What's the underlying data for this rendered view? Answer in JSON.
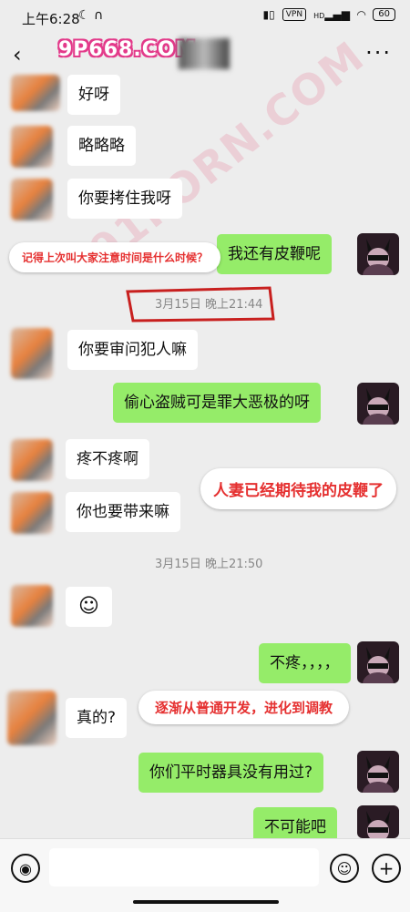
{
  "status_bar": {
    "time": "上午6:28",
    "vpn": "VPN",
    "hd": "HD",
    "battery": "60"
  },
  "header": {
    "watermark_site": "9P668.COM"
  },
  "watermark_diag": "91PORN.COM",
  "messages": [
    {
      "side": "left",
      "text": "好呀"
    },
    {
      "side": "left",
      "text": "略略略"
    },
    {
      "side": "left",
      "text": "你要拷住我呀"
    },
    {
      "side": "right",
      "text": "我还有皮鞭呢"
    },
    {
      "side": "left",
      "text": "你要审问犯人嘛"
    },
    {
      "side": "right",
      "text": "偷心盗贼可是罪大恶极的呀"
    },
    {
      "side": "left",
      "text": "疼不疼啊"
    },
    {
      "side": "left",
      "text": "你也要带来嘛"
    },
    {
      "side": "left",
      "text": "☺"
    },
    {
      "side": "right",
      "text": "不疼，，，，"
    },
    {
      "side": "left",
      "text": "真的?"
    },
    {
      "side": "right",
      "text": "你们平时器具没有用过?"
    },
    {
      "side": "right",
      "text": "不可能吧"
    }
  ],
  "timestamps": [
    "3月15日 晚上21:44",
    "3月15日 晚上21:50"
  ],
  "annotations": [
    "记得上次叫大家注意时间是什么时候？",
    "人妻已经期待我的皮鞭了",
    "逐渐从普通开发，进化到调教"
  ]
}
